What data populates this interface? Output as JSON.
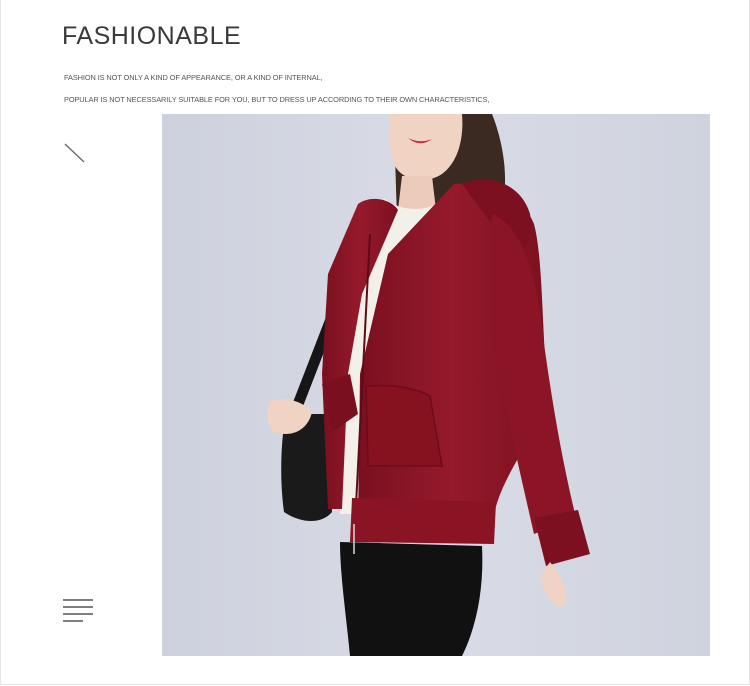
{
  "heading": {
    "title": "FASHIONABLE",
    "line1": "FASHION IS NOT ONLY A KIND OF APPEARANCE, OR A KIND OF INTERNAL,",
    "line2": "POPULAR IS NOT NECESSARILY SUITABLE FOR YOU, BUT TO DRESS UP ACCORDING TO THEIR OWN CHARACTERISTICS,"
  },
  "icons": {
    "decor_top": "diagonal-line-icon",
    "decor_bottom": "text-lines-icon"
  },
  "photo": {
    "subject": "model-wearing-red-hooded-zip-jacket",
    "colors": {
      "background": "#d4d8e2",
      "jacket": "#8e1526",
      "sweater": "#f3f0ea",
      "pants": "#111111",
      "hair": "#3b2a22"
    }
  }
}
